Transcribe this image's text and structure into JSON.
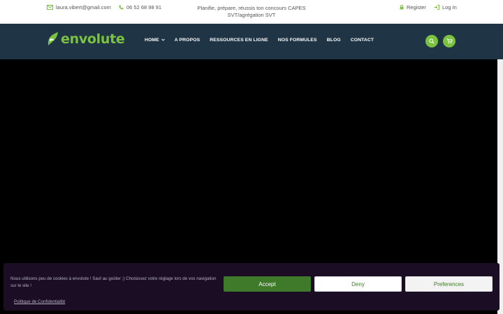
{
  "topbar": {
    "email": "laura.vibert@gmail.com",
    "phone": "06 52 68 98 91",
    "tagline": "Planifie, prépare, réussis ton concours CAPES SVT/agrégation SVT",
    "register": "Register",
    "login": "Log In",
    "icons": [
      "envelope-icon",
      "phone-icon",
      "lock-icon",
      "login-icon"
    ]
  },
  "header": {
    "logo_text": "envolute",
    "nav": [
      {
        "label": "HOME",
        "has_dropdown": true
      },
      {
        "label": "A PROPOS"
      },
      {
        "label": "RESSOURCES EN LIGNE"
      },
      {
        "label": "NOS FORMULES"
      },
      {
        "label": "BLOG"
      },
      {
        "label": "CONTACT"
      }
    ],
    "actions": [
      "search-icon",
      "cart-icon"
    ]
  },
  "cookie_banner": {
    "message": "Nous utilisons peu de cookies à envolute ! Sauf au goûter ;) Choisissez votre réglage lors de vos navigation sur le site !",
    "policy_link": "Politique de Confidentialité",
    "accept": "Accept",
    "deny": "Deny",
    "preferences": "Preferences"
  },
  "colors": {
    "header_bg": "#1f3445",
    "brand_green": "#7cc242",
    "accept_green": "#3e7a2a",
    "cookie_bg": "#1a0d24",
    "video_bg": "#000000"
  }
}
